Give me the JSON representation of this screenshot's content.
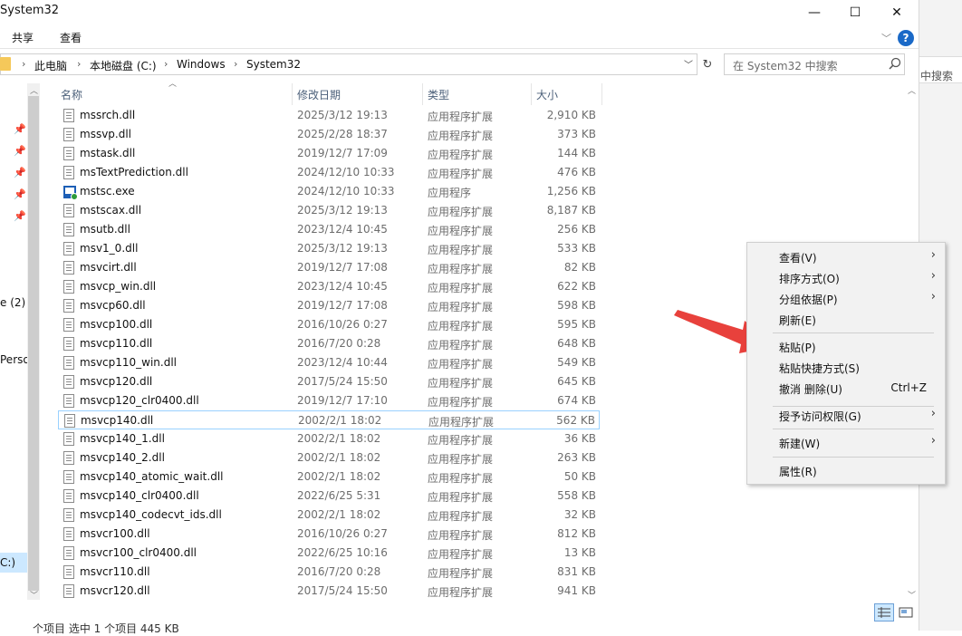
{
  "window": {
    "title": "System32"
  },
  "window_buttons": {
    "minimize": "—",
    "maximize": "☐",
    "close": "✕"
  },
  "ribbon": {
    "tabs": [
      "共享",
      "查看"
    ],
    "help": "?"
  },
  "address": {
    "crumbs": [
      "此电脑",
      "本地磁盘 (C:)",
      "Windows",
      "System32"
    ],
    "separator": "›"
  },
  "search": {
    "placeholder": "在 System32 中搜索"
  },
  "background_window": {
    "search_hint": "中搜索"
  },
  "nav": {
    "labels": [
      "e (2)",
      "Perso",
      "C:)"
    ]
  },
  "columns": {
    "name": "名称",
    "date": "修改日期",
    "type": "类型",
    "size": "大小"
  },
  "files": [
    {
      "name": "mssrch.dll",
      "date": "2025/3/12 19:13",
      "type": "应用程序扩展",
      "size": "2,910 KB",
      "icon": "dll"
    },
    {
      "name": "mssvp.dll",
      "date": "2025/2/28 18:37",
      "type": "应用程序扩展",
      "size": "373 KB",
      "icon": "dll"
    },
    {
      "name": "mstask.dll",
      "date": "2019/12/7 17:09",
      "type": "应用程序扩展",
      "size": "144 KB",
      "icon": "dll"
    },
    {
      "name": "msTextPrediction.dll",
      "date": "2024/12/10 10:33",
      "type": "应用程序扩展",
      "size": "476 KB",
      "icon": "dll"
    },
    {
      "name": "mstsc.exe",
      "date": "2024/12/10 10:33",
      "type": "应用程序",
      "size": "1,256 KB",
      "icon": "exe"
    },
    {
      "name": "mstscax.dll",
      "date": "2025/3/12 19:13",
      "type": "应用程序扩展",
      "size": "8,187 KB",
      "icon": "dll"
    },
    {
      "name": "msutb.dll",
      "date": "2023/12/4 10:45",
      "type": "应用程序扩展",
      "size": "256 KB",
      "icon": "dll"
    },
    {
      "name": "msv1_0.dll",
      "date": "2025/3/12 19:13",
      "type": "应用程序扩展",
      "size": "533 KB",
      "icon": "dll"
    },
    {
      "name": "msvcirt.dll",
      "date": "2019/12/7 17:08",
      "type": "应用程序扩展",
      "size": "82 KB",
      "icon": "dll"
    },
    {
      "name": "msvcp_win.dll",
      "date": "2023/12/4 10:45",
      "type": "应用程序扩展",
      "size": "622 KB",
      "icon": "dll"
    },
    {
      "name": "msvcp60.dll",
      "date": "2019/12/7 17:08",
      "type": "应用程序扩展",
      "size": "598 KB",
      "icon": "dll"
    },
    {
      "name": "msvcp100.dll",
      "date": "2016/10/26 0:27",
      "type": "应用程序扩展",
      "size": "595 KB",
      "icon": "dll"
    },
    {
      "name": "msvcp110.dll",
      "date": "2016/7/20 0:28",
      "type": "应用程序扩展",
      "size": "648 KB",
      "icon": "dll"
    },
    {
      "name": "msvcp110_win.dll",
      "date": "2023/12/4 10:44",
      "type": "应用程序扩展",
      "size": "549 KB",
      "icon": "dll"
    },
    {
      "name": "msvcp120.dll",
      "date": "2017/5/24 15:50",
      "type": "应用程序扩展",
      "size": "645 KB",
      "icon": "dll"
    },
    {
      "name": "msvcp120_clr0400.dll",
      "date": "2019/12/7 17:10",
      "type": "应用程序扩展",
      "size": "674 KB",
      "icon": "dll"
    },
    {
      "name": "msvcp140.dll",
      "date": "2002/2/1 18:02",
      "type": "应用程序扩展",
      "size": "562 KB",
      "icon": "dll",
      "selected": true
    },
    {
      "name": "msvcp140_1.dll",
      "date": "2002/2/1 18:02",
      "type": "应用程序扩展",
      "size": "36 KB",
      "icon": "dll"
    },
    {
      "name": "msvcp140_2.dll",
      "date": "2002/2/1 18:02",
      "type": "应用程序扩展",
      "size": "263 KB",
      "icon": "dll"
    },
    {
      "name": "msvcp140_atomic_wait.dll",
      "date": "2002/2/1 18:02",
      "type": "应用程序扩展",
      "size": "50 KB",
      "icon": "dll"
    },
    {
      "name": "msvcp140_clr0400.dll",
      "date": "2022/6/25 5:31",
      "type": "应用程序扩展",
      "size": "558 KB",
      "icon": "dll"
    },
    {
      "name": "msvcp140_codecvt_ids.dll",
      "date": "2002/2/1 18:02",
      "type": "应用程序扩展",
      "size": "32 KB",
      "icon": "dll"
    },
    {
      "name": "msvcr100.dll",
      "date": "2016/10/26 0:27",
      "type": "应用程序扩展",
      "size": "812 KB",
      "icon": "dll"
    },
    {
      "name": "msvcr100_clr0400.dll",
      "date": "2022/6/25 10:16",
      "type": "应用程序扩展",
      "size": "13 KB",
      "icon": "dll"
    },
    {
      "name": "msvcr110.dll",
      "date": "2016/7/20 0:28",
      "type": "应用程序扩展",
      "size": "831 KB",
      "icon": "dll"
    },
    {
      "name": "msvcr120.dll",
      "date": "2017/5/24 15:50",
      "type": "应用程序扩展",
      "size": "941 KB",
      "icon": "dll"
    }
  ],
  "context_menu": {
    "items": [
      {
        "label": "查看(V)",
        "submenu": true
      },
      {
        "label": "排序方式(O)",
        "submenu": true
      },
      {
        "label": "分组依据(P)",
        "submenu": true
      },
      {
        "label": "刷新(E)"
      },
      {
        "separator": true
      },
      {
        "label": "粘贴(P)"
      },
      {
        "label": "粘贴快捷方式(S)"
      },
      {
        "label": "撤消 删除(U)",
        "shortcut": "Ctrl+Z"
      },
      {
        "separator": true
      },
      {
        "label": "授予访问权限(G)",
        "submenu": true
      },
      {
        "separator": true
      },
      {
        "label": "新建(W)",
        "submenu": true
      },
      {
        "separator": true
      },
      {
        "label": "属性(R)"
      }
    ]
  },
  "status": {
    "text": "个项目   选中 1 个项目  445 KB"
  },
  "colors": {
    "selection_border": "#99d1ff",
    "accent": "#1a69c7",
    "annotation": "#e8413c"
  }
}
